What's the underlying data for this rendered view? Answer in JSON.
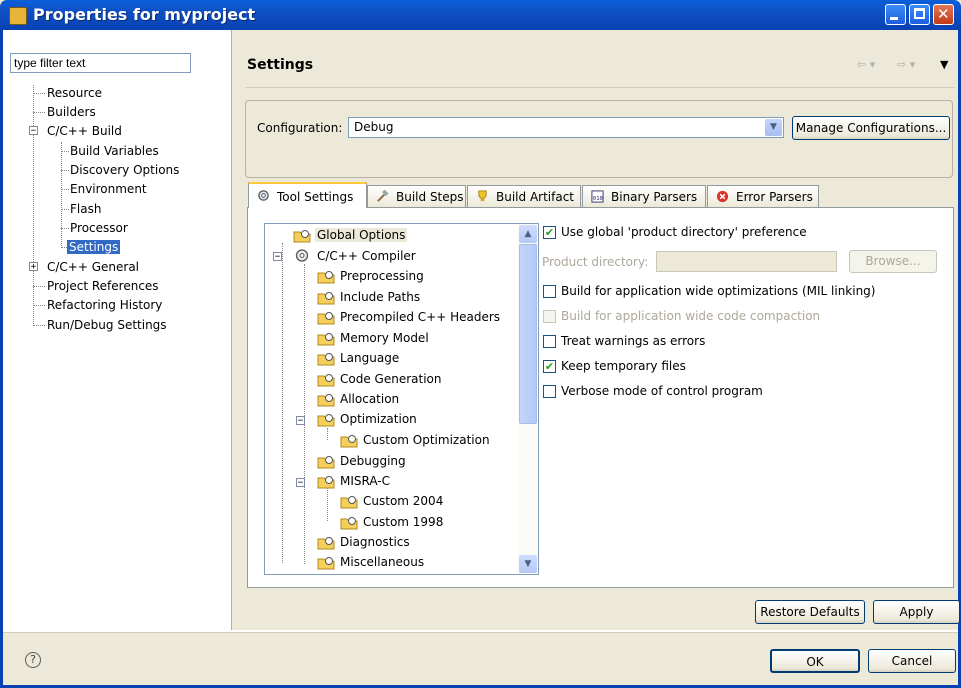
{
  "window": {
    "title": "Properties for myproject"
  },
  "filter": {
    "placeholder": "type filter text",
    "value": "type filter text"
  },
  "nav_tree": {
    "resource": "Resource",
    "builders": "Builders",
    "cpp_build": "C/C++ Build",
    "build_variables": "Build Variables",
    "discovery_options": "Discovery Options",
    "environment": "Environment",
    "flash": "Flash",
    "processor": "Processor",
    "settings": "Settings",
    "cpp_general": "C/C++ General",
    "project_references": "Project References",
    "refactoring_history": "Refactoring History",
    "run_debug_settings": "Run/Debug Settings"
  },
  "page": {
    "title": "Settings"
  },
  "configuration": {
    "label": "Configuration:",
    "value": "Debug",
    "manage_label": "Manage Configurations..."
  },
  "tabs": {
    "tool_settings": "Tool Settings",
    "build_steps": "Build Steps",
    "build_artifact": "Build Artifact",
    "binary_parsers": "Binary Parsers",
    "error_parsers": "Error Parsers"
  },
  "tool_tree": {
    "global_options": "Global Options",
    "compiler": "C/C++ Compiler",
    "preprocessing": "Preprocessing",
    "include_paths": "Include Paths",
    "precompiled_headers": "Precompiled C++ Headers",
    "memory_model": "Memory Model",
    "language": "Language",
    "code_generation": "Code Generation",
    "allocation": "Allocation",
    "optimization": "Optimization",
    "custom_optimization": "Custom Optimization",
    "debugging": "Debugging",
    "misra_c": "MISRA-C",
    "custom_2004": "Custom 2004",
    "custom_1998": "Custom 1998",
    "diagnostics": "Diagnostics",
    "miscellaneous": "Miscellaneous"
  },
  "options": {
    "use_global_dir": {
      "label": "Use global 'product directory' preference",
      "checked": true
    },
    "product_dir_label": "Product directory:",
    "product_dir_value": "",
    "browse_label": "Browse...",
    "mil_linking": {
      "label": "Build for application wide optimizations (MIL linking)",
      "checked": false
    },
    "code_compaction": {
      "label": "Build for application wide code compaction",
      "checked": false
    },
    "warnings_errors": {
      "label": "Treat warnings as errors",
      "checked": false
    },
    "keep_temp": {
      "label": "Keep temporary files",
      "checked": true
    },
    "verbose": {
      "label": "Verbose mode of control program",
      "checked": false
    }
  },
  "buttons": {
    "restore_defaults": "Restore Defaults",
    "apply": "Apply",
    "ok": "OK",
    "cancel": "Cancel"
  },
  "colors": {
    "titlebar": "#0842b3",
    "selection": "#316ac5",
    "tab_highlight": "#ffc83c",
    "check": "#21a121"
  }
}
